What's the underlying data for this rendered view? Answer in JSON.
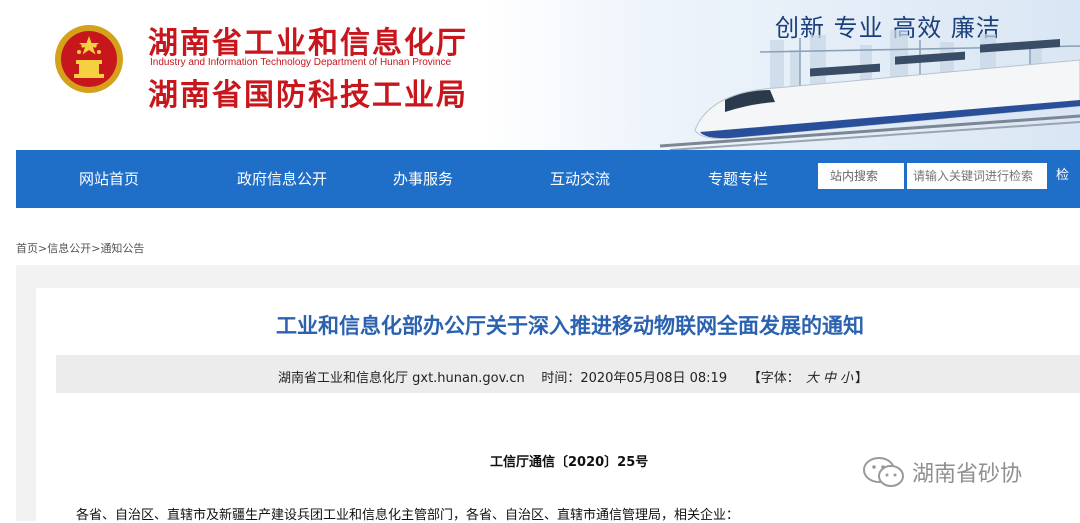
{
  "header": {
    "title_cn_1": "湖南省工业和信息化厅",
    "title_en": "Industry and Information Technology Department of Hunan Province",
    "title_cn_2": "湖南省国防科技工业局",
    "slogan": "创新 专业 高效 廉洁"
  },
  "nav": {
    "items": [
      {
        "label": "网站首页"
      },
      {
        "label": "政府信息公开"
      },
      {
        "label": "办事服务"
      },
      {
        "label": "互动交流"
      },
      {
        "label": "专题专栏"
      }
    ],
    "search_label": "站内搜索",
    "search_placeholder": "请输入关键词进行检索",
    "search_button": "检"
  },
  "breadcrumb": {
    "home": "首页",
    "sep": ">",
    "info": "信息公开",
    "notice": "通知公告"
  },
  "article": {
    "title": "工业和信息化部办公厅关于深入推进移动物联网全面发展的通知",
    "source": "湖南省工业和信息化厅 gxt.hunan.gov.cn",
    "time_label": "时间：",
    "time_value": "2020年05月08日 08:19",
    "font_prefix": "【字体：",
    "font_large": "大",
    "font_medium": "中",
    "font_small": "小",
    "font_suffix": "】",
    "doc_number": "工信厅通信〔2020〕25号",
    "addressee": "各省、自治区、直辖市及新疆生产建设兵团工业和信息化主管部门，各省、自治区、直辖市通信管理局，相关企业："
  },
  "watermark": {
    "text": "湖南省砂协",
    "icon": "wechat-icon"
  },
  "colors": {
    "brand_red": "#c8161d",
    "nav_blue": "#1f6fc9",
    "title_blue": "#2b62b0"
  }
}
